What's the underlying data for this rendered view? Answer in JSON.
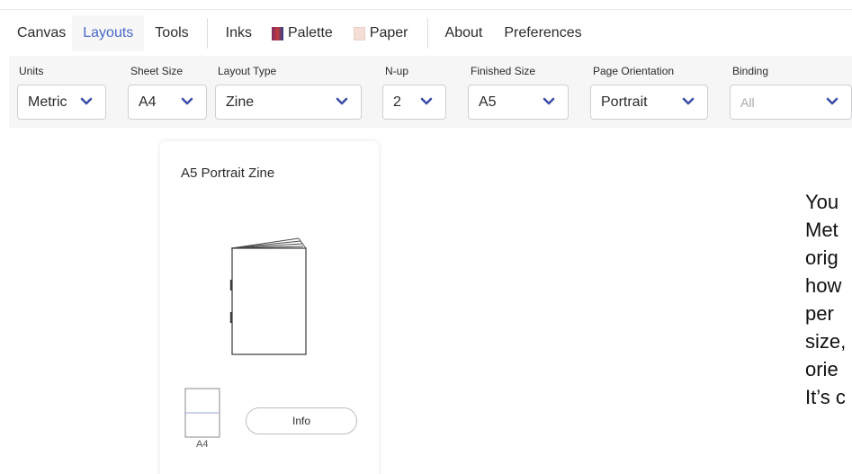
{
  "menu": {
    "items": [
      {
        "label": "Canvas",
        "active": false
      },
      {
        "label": "Layouts",
        "active": true
      },
      {
        "label": "Tools",
        "active": false
      },
      {
        "label": "Inks",
        "active": false
      },
      {
        "label": "Palette",
        "active": false,
        "swatch": "palette"
      },
      {
        "label": "Paper",
        "active": false,
        "swatch": "paper"
      },
      {
        "label": "About",
        "active": false
      },
      {
        "label": "Preferences",
        "active": false
      }
    ]
  },
  "controls": {
    "units": {
      "label": "Units",
      "value": "Metric"
    },
    "sheet_size": {
      "label": "Sheet Size",
      "value": "A4"
    },
    "layout_type": {
      "label": "Layout Type",
      "value": "Zine"
    },
    "n_up": {
      "label": "N-up",
      "value": "2"
    },
    "finished_size": {
      "label": "Finished Size",
      "value": "A5"
    },
    "page_orientation": {
      "label": "Page Orientation",
      "value": "Portrait"
    },
    "binding": {
      "label": "Binding",
      "value": "All",
      "disabled": true
    }
  },
  "card": {
    "title": "A5 Portrait Zine",
    "info_label": "Info",
    "sheet_label": "A4"
  },
  "side_text": {
    "lines": [
      "You",
      "Met",
      "orig",
      "how",
      "per",
      "size,",
      "orie",
      "It’s c"
    ]
  },
  "colors": {
    "accent": "#4a68c8",
    "chevron": "#3d4fa8",
    "panel_bg": "#f6f6f7"
  }
}
